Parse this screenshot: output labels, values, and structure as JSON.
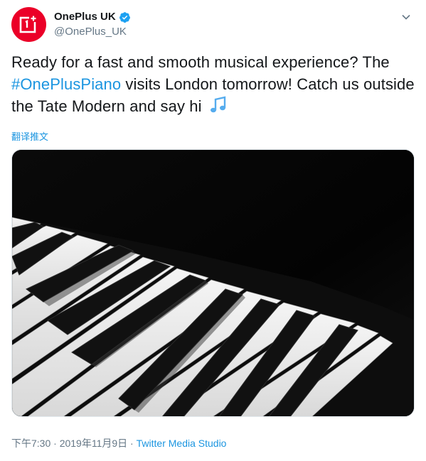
{
  "author": {
    "display_name": "OnePlus UK",
    "handle": "@OnePlus_UK",
    "avatar_icon": "oneplus-logo-icon",
    "verified_icon": "verified-badge-icon",
    "brand_color": "#eb0028"
  },
  "tweet": {
    "text_before": "Ready for a fast and smooth musical experience? The ",
    "hashtag": "#OnePlusPiano",
    "text_after": " visits London tomorrow! Catch us outside the Tate Modern and say hi ",
    "emoji_icon": "musical-notes-icon",
    "translate_label": "翻译推文"
  },
  "media": {
    "image_icon": "piano-keys-photo"
  },
  "meta": {
    "time": "下午7:30",
    "separator": " · ",
    "date": "2019年11月9日",
    "separator2": " · ",
    "source": "Twitter Media Studio"
  },
  "colors": {
    "link": "#1b95e0",
    "secondary_text": "#657786",
    "primary_text": "#14171a"
  },
  "menu": {
    "caret_icon": "chevron-down-icon"
  }
}
